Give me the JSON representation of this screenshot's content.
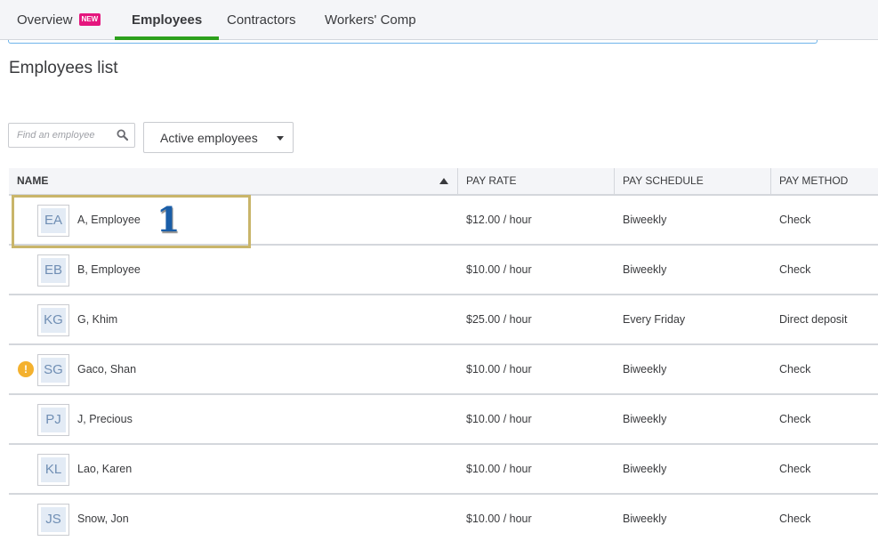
{
  "tabs": [
    {
      "label": "Overview",
      "badge": "NEW",
      "active": false
    },
    {
      "label": "Employees",
      "active": true
    },
    {
      "label": "Contractors",
      "active": false
    },
    {
      "label": "Workers' Comp",
      "active": false
    }
  ],
  "page": {
    "title": "Employees list"
  },
  "filters": {
    "search_placeholder": "Find an employee",
    "search_value": "",
    "status_selected": "Active employees"
  },
  "table": {
    "columns": [
      "NAME",
      "PAY RATE",
      "PAY SCHEDULE",
      "PAY METHOD"
    ],
    "sort": {
      "column": "NAME",
      "direction": "ascending"
    },
    "rows": [
      {
        "initials": "EA",
        "name": "A, Employee",
        "pay_rate": "$12.00 / hour",
        "pay_schedule": "Biweekly",
        "pay_method": "Check",
        "alert": false
      },
      {
        "initials": "EB",
        "name": "B, Employee",
        "pay_rate": "$10.00 / hour",
        "pay_schedule": "Biweekly",
        "pay_method": "Check",
        "alert": false
      },
      {
        "initials": "KG",
        "name": "G, Khim",
        "pay_rate": "$25.00 / hour",
        "pay_schedule": "Every Friday",
        "pay_method": "Direct deposit",
        "alert": false
      },
      {
        "initials": "SG",
        "name": "Gaco, Shan",
        "pay_rate": "$10.00 / hour",
        "pay_schedule": "Biweekly",
        "pay_method": "Check",
        "alert": true,
        "alert_glyph": "!"
      },
      {
        "initials": "PJ",
        "name": "J, Precious",
        "pay_rate": "$10.00 / hour",
        "pay_schedule": "Biweekly",
        "pay_method": "Check",
        "alert": false
      },
      {
        "initials": "KL",
        "name": "Lao, Karen",
        "pay_rate": "$10.00 / hour",
        "pay_schedule": "Biweekly",
        "pay_method": "Check",
        "alert": false
      },
      {
        "initials": "JS",
        "name": "Snow, Jon",
        "pay_rate": "$10.00 / hour",
        "pay_schedule": "Biweekly",
        "pay_method": "Check",
        "alert": false
      }
    ]
  },
  "annotation": {
    "step_number": "1",
    "highlight_color": "#c9b56a"
  },
  "colors": {
    "accent_green": "#2ca01c",
    "badge_pink": "#e5167e",
    "alert_orange": "#f4b12e"
  }
}
